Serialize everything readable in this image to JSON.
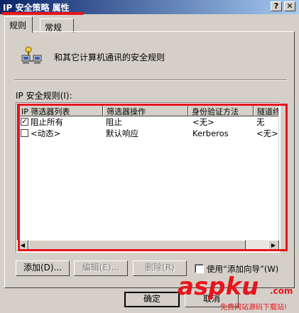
{
  "window": {
    "title": "IP 安全策略 属性",
    "help_button": "?",
    "close_button": "✕"
  },
  "tabs": [
    {
      "label": "规则",
      "active": true
    },
    {
      "label": "常规",
      "active": false
    }
  ],
  "description": "和其它计算机通讯的安全规则",
  "list_label": "IP 安全规则(I):",
  "columns": [
    "IP 筛选器列表",
    "筛选器操作",
    "身份验证方法",
    "隧道终"
  ],
  "rows": [
    {
      "checked": true,
      "filter_list": "阻止所有",
      "filter_action": "阻止",
      "auth": "<无>",
      "tunnel": "无"
    },
    {
      "checked": false,
      "filter_list": "<动态>",
      "filter_action": "默认响应",
      "auth": "Kerberos",
      "tunnel": "<无>"
    }
  ],
  "buttons": {
    "add": "添加(D)...",
    "edit": "编辑(E)...",
    "delete": "删除(R)",
    "ok": "确定",
    "cancel": "取消"
  },
  "wizard_checkbox": {
    "label": "使用“添加向导”(W)",
    "checked": false
  },
  "watermark": {
    "brand": "aspku",
    "suffix": ".com",
    "tagline": "免费网站源码下载站!"
  },
  "colors": {
    "highlight": "#e8141c",
    "titlebar": "#0a246a"
  }
}
